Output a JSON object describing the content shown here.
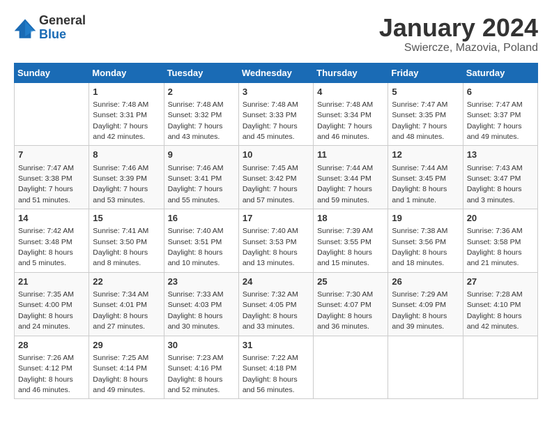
{
  "header": {
    "logo": {
      "general": "General",
      "blue": "Blue"
    },
    "title": "January 2024",
    "subtitle": "Swiercze, Mazovia, Poland"
  },
  "weekdays": [
    "Sunday",
    "Monday",
    "Tuesday",
    "Wednesday",
    "Thursday",
    "Friday",
    "Saturday"
  ],
  "weeks": [
    [
      {
        "day": "",
        "info": ""
      },
      {
        "day": "1",
        "info": "Sunrise: 7:48 AM\nSunset: 3:31 PM\nDaylight: 7 hours\nand 42 minutes."
      },
      {
        "day": "2",
        "info": "Sunrise: 7:48 AM\nSunset: 3:32 PM\nDaylight: 7 hours\nand 43 minutes."
      },
      {
        "day": "3",
        "info": "Sunrise: 7:48 AM\nSunset: 3:33 PM\nDaylight: 7 hours\nand 45 minutes."
      },
      {
        "day": "4",
        "info": "Sunrise: 7:48 AM\nSunset: 3:34 PM\nDaylight: 7 hours\nand 46 minutes."
      },
      {
        "day": "5",
        "info": "Sunrise: 7:47 AM\nSunset: 3:35 PM\nDaylight: 7 hours\nand 48 minutes."
      },
      {
        "day": "6",
        "info": "Sunrise: 7:47 AM\nSunset: 3:37 PM\nDaylight: 7 hours\nand 49 minutes."
      }
    ],
    [
      {
        "day": "7",
        "info": "Sunrise: 7:47 AM\nSunset: 3:38 PM\nDaylight: 7 hours\nand 51 minutes."
      },
      {
        "day": "8",
        "info": "Sunrise: 7:46 AM\nSunset: 3:39 PM\nDaylight: 7 hours\nand 53 minutes."
      },
      {
        "day": "9",
        "info": "Sunrise: 7:46 AM\nSunset: 3:41 PM\nDaylight: 7 hours\nand 55 minutes."
      },
      {
        "day": "10",
        "info": "Sunrise: 7:45 AM\nSunset: 3:42 PM\nDaylight: 7 hours\nand 57 minutes."
      },
      {
        "day": "11",
        "info": "Sunrise: 7:44 AM\nSunset: 3:44 PM\nDaylight: 7 hours\nand 59 minutes."
      },
      {
        "day": "12",
        "info": "Sunrise: 7:44 AM\nSunset: 3:45 PM\nDaylight: 8 hours\nand 1 minute."
      },
      {
        "day": "13",
        "info": "Sunrise: 7:43 AM\nSunset: 3:47 PM\nDaylight: 8 hours\nand 3 minutes."
      }
    ],
    [
      {
        "day": "14",
        "info": "Sunrise: 7:42 AM\nSunset: 3:48 PM\nDaylight: 8 hours\nand 5 minutes."
      },
      {
        "day": "15",
        "info": "Sunrise: 7:41 AM\nSunset: 3:50 PM\nDaylight: 8 hours\nand 8 minutes."
      },
      {
        "day": "16",
        "info": "Sunrise: 7:40 AM\nSunset: 3:51 PM\nDaylight: 8 hours\nand 10 minutes."
      },
      {
        "day": "17",
        "info": "Sunrise: 7:40 AM\nSunset: 3:53 PM\nDaylight: 8 hours\nand 13 minutes."
      },
      {
        "day": "18",
        "info": "Sunrise: 7:39 AM\nSunset: 3:55 PM\nDaylight: 8 hours\nand 15 minutes."
      },
      {
        "day": "19",
        "info": "Sunrise: 7:38 AM\nSunset: 3:56 PM\nDaylight: 8 hours\nand 18 minutes."
      },
      {
        "day": "20",
        "info": "Sunrise: 7:36 AM\nSunset: 3:58 PM\nDaylight: 8 hours\nand 21 minutes."
      }
    ],
    [
      {
        "day": "21",
        "info": "Sunrise: 7:35 AM\nSunset: 4:00 PM\nDaylight: 8 hours\nand 24 minutes."
      },
      {
        "day": "22",
        "info": "Sunrise: 7:34 AM\nSunset: 4:01 PM\nDaylight: 8 hours\nand 27 minutes."
      },
      {
        "day": "23",
        "info": "Sunrise: 7:33 AM\nSunset: 4:03 PM\nDaylight: 8 hours\nand 30 minutes."
      },
      {
        "day": "24",
        "info": "Sunrise: 7:32 AM\nSunset: 4:05 PM\nDaylight: 8 hours\nand 33 minutes."
      },
      {
        "day": "25",
        "info": "Sunrise: 7:30 AM\nSunset: 4:07 PM\nDaylight: 8 hours\nand 36 minutes."
      },
      {
        "day": "26",
        "info": "Sunrise: 7:29 AM\nSunset: 4:09 PM\nDaylight: 8 hours\nand 39 minutes."
      },
      {
        "day": "27",
        "info": "Sunrise: 7:28 AM\nSunset: 4:10 PM\nDaylight: 8 hours\nand 42 minutes."
      }
    ],
    [
      {
        "day": "28",
        "info": "Sunrise: 7:26 AM\nSunset: 4:12 PM\nDaylight: 8 hours\nand 46 minutes."
      },
      {
        "day": "29",
        "info": "Sunrise: 7:25 AM\nSunset: 4:14 PM\nDaylight: 8 hours\nand 49 minutes."
      },
      {
        "day": "30",
        "info": "Sunrise: 7:23 AM\nSunset: 4:16 PM\nDaylight: 8 hours\nand 52 minutes."
      },
      {
        "day": "31",
        "info": "Sunrise: 7:22 AM\nSunset: 4:18 PM\nDaylight: 8 hours\nand 56 minutes."
      },
      {
        "day": "",
        "info": ""
      },
      {
        "day": "",
        "info": ""
      },
      {
        "day": "",
        "info": ""
      }
    ]
  ]
}
